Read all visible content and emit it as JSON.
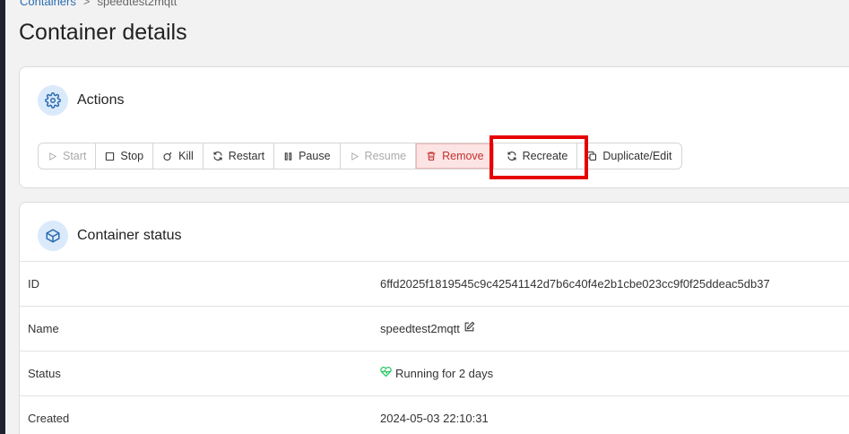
{
  "breadcrumb": {
    "parent": "Containers",
    "separator": ">",
    "current": "speedtest2mqtt"
  },
  "page": {
    "title": "Container details"
  },
  "actions": {
    "title": "Actions",
    "buttons": {
      "start": "Start",
      "stop": "Stop",
      "kill": "Kill",
      "restart": "Restart",
      "pause": "Pause",
      "resume": "Resume",
      "remove": "Remove",
      "recreate": "Recreate",
      "duplicate": "Duplicate/Edit"
    }
  },
  "status": {
    "title": "Container status",
    "rows": {
      "id": {
        "label": "ID",
        "value": "6ffd2025f1819545c9c42541142d7b6c40f4e2b1cbe023cc9f0f25ddeac5db37"
      },
      "name": {
        "label": "Name",
        "value": "speedtest2mqtt"
      },
      "status": {
        "label": "Status",
        "value": "Running for 2 days"
      },
      "created": {
        "label": "Created",
        "value": "2024-05-03 22:10:31"
      }
    }
  },
  "colors": {
    "accent": "#2b6cb0",
    "danger": "#c53030",
    "success": "#22c55e",
    "highlight": "#e60000"
  }
}
